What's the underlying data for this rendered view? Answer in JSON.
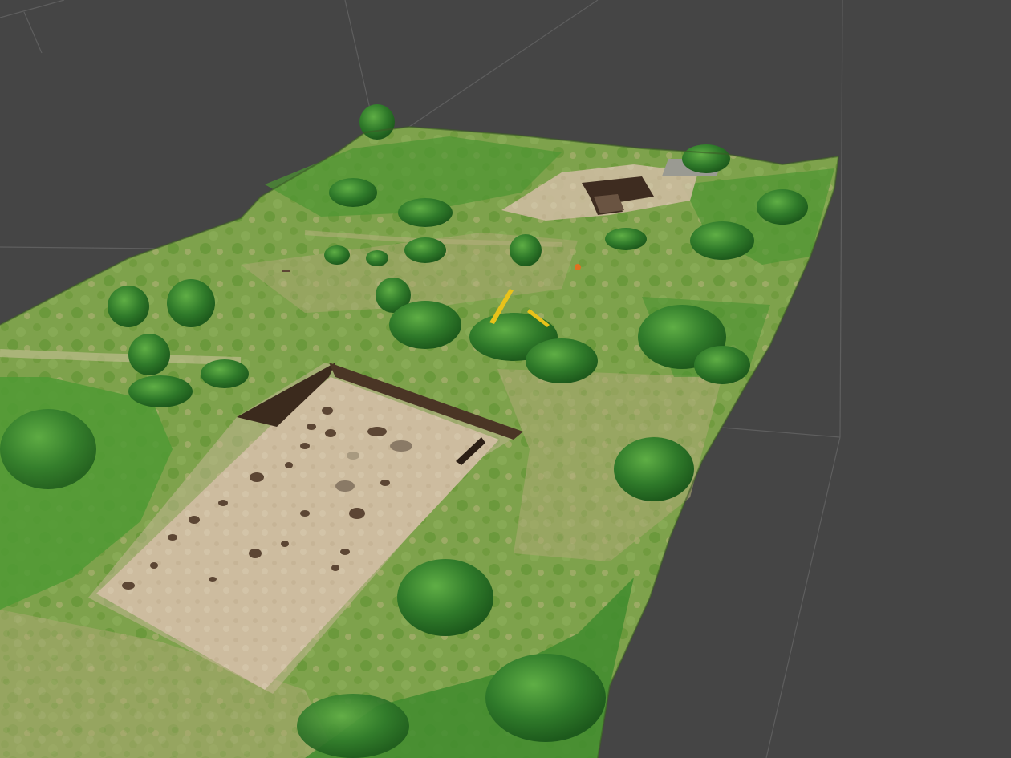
{
  "scene": {
    "background_color": "#454545",
    "grid_line_color": "#5e5e5e",
    "grass_color": "#5a9a3a",
    "dry_grass_color": "#a9ab6e",
    "soil_color": "#cdbb9f",
    "trench_wall_color": "#4a3525",
    "shrub_color": "#2f7a2a",
    "marker_color": "#e8c21a",
    "marker_orange": "#e07020"
  }
}
